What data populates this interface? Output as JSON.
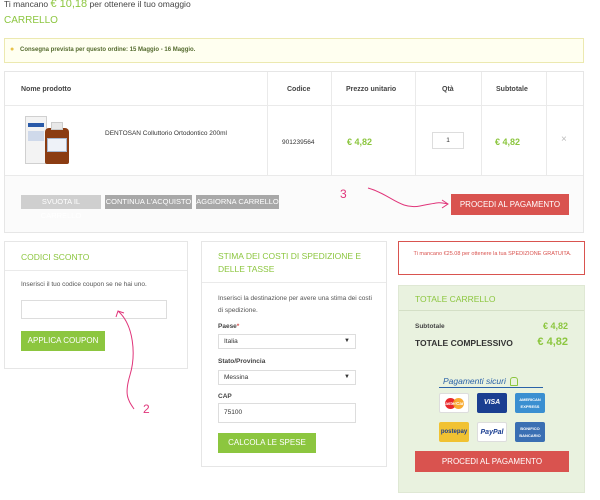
{
  "banner": {
    "prefix": "Ti mancano",
    "amount": "€ 10,18",
    "suffix": "per ottenere il tuo omaggio"
  },
  "page_title": "CARRELLO",
  "delivery_notice": "Consegna prevista per questo ordine: 15 Maggio - 16 Maggio.",
  "table": {
    "headers": [
      "Nome prodotto",
      "Codice",
      "Prezzo unitario",
      "Qtà",
      "Subtotale"
    ],
    "rows": [
      {
        "name": "DENTOSAN Colluttorio Ortodontico 200ml",
        "code": "901239564",
        "price": "€ 4,82",
        "qty": "1",
        "subtotal": "€ 4,82",
        "remove": "×"
      }
    ]
  },
  "actions": {
    "empty_cart": "SVUOTA IL CARRELLO",
    "continue_shopping": "CONTINUA L'ACQUISTO",
    "update_cart": "AGGIORNA CARRELLO",
    "checkout": "PROCEDI AL PAGAMENTO"
  },
  "annotations": {
    "step2": "2",
    "step3": "3"
  },
  "coupon": {
    "title": "CODICI SCONTO",
    "description": "Inserisci il tuo codice coupon se ne hai uno.",
    "input_value": "",
    "apply_label": "APPLICA COUPON"
  },
  "shipping": {
    "title_line1": "STIMA DEI COSTI DI SPEDIZIONE E",
    "title_line2": "DELLE TASSE",
    "description": "Inserisci la destinazione per avere una stima dei costi di spedizione.",
    "country_label": "Paese",
    "country_required": "*",
    "country_value": "Italia",
    "state_label": "Stato/Provincia",
    "state_value": "Messina",
    "zip_label": "CAP",
    "zip_value": "75100",
    "calc_label": "CALCOLA LE SPESE"
  },
  "free_shipping_notice": "Ti mancano €25.08 per ottenere la tua SPEDIZIONE GRATUITA.",
  "totals": {
    "title": "TOTALE CARRELLO",
    "subtotal_label": "Subtotale",
    "subtotal_value": "€ 4,82",
    "total_label": "TOTALE COMPLESSIVO",
    "total_value": "€ 4,82",
    "secure_payments": "Pagamenti sicuri",
    "payment_methods": [
      "MasterCard",
      "VISA",
      "AMERICAN EXPRESS",
      "postepay",
      "PayPal",
      "BONIFICO BANCARIO"
    ],
    "checkout_label": "PROCEDI AL PAGAMENTO"
  },
  "colors": {
    "accent_green": "#8cc63f",
    "checkout_red": "#d9534f",
    "annotation_pink": "#e0357a"
  }
}
